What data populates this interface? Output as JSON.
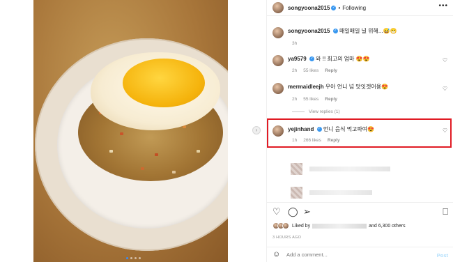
{
  "header": {
    "username": "songyoona2015",
    "separator": "•",
    "follow_label": "Following",
    "more": "•••"
  },
  "caption": {
    "username": "songyoona2015",
    "text": "매일매일 널 위해...😅😁",
    "time": "3h"
  },
  "comments": [
    {
      "username": "ya9579",
      "text": "와 !! 최고의 엄마 😍😍",
      "time": "2h",
      "likes": "55 likes",
      "reply": "Reply"
    },
    {
      "username": "mermaidleejh",
      "text": "우아 언니 넘 맛잇겟어용😍",
      "time": "2h",
      "likes": "55 likes",
      "reply": "Reply"
    },
    {
      "username": "yejinhand",
      "text": "언니 음식 먹고파여😍",
      "time": "1h",
      "likes": "266 likes",
      "reply": "Reply"
    }
  ],
  "view_replies": "View replies (1)",
  "likes": {
    "prefix": "Liked by",
    "suffix": "and 6,300 others"
  },
  "timestamp": "3 HOURS AGO",
  "add_comment": {
    "placeholder": "Add a comment...",
    "post_label": "Post"
  },
  "icons": {
    "more": "more-options-icon",
    "heart": "heart-icon",
    "comment": "comment-icon",
    "share": "share-icon",
    "save": "bookmark-icon",
    "emoji": "emoji-icon",
    "next": "chevron-right-icon"
  },
  "colors": {
    "highlight_border": "#e01b24",
    "verified": "#3897f0",
    "post_disabled": "#b2dffc"
  }
}
